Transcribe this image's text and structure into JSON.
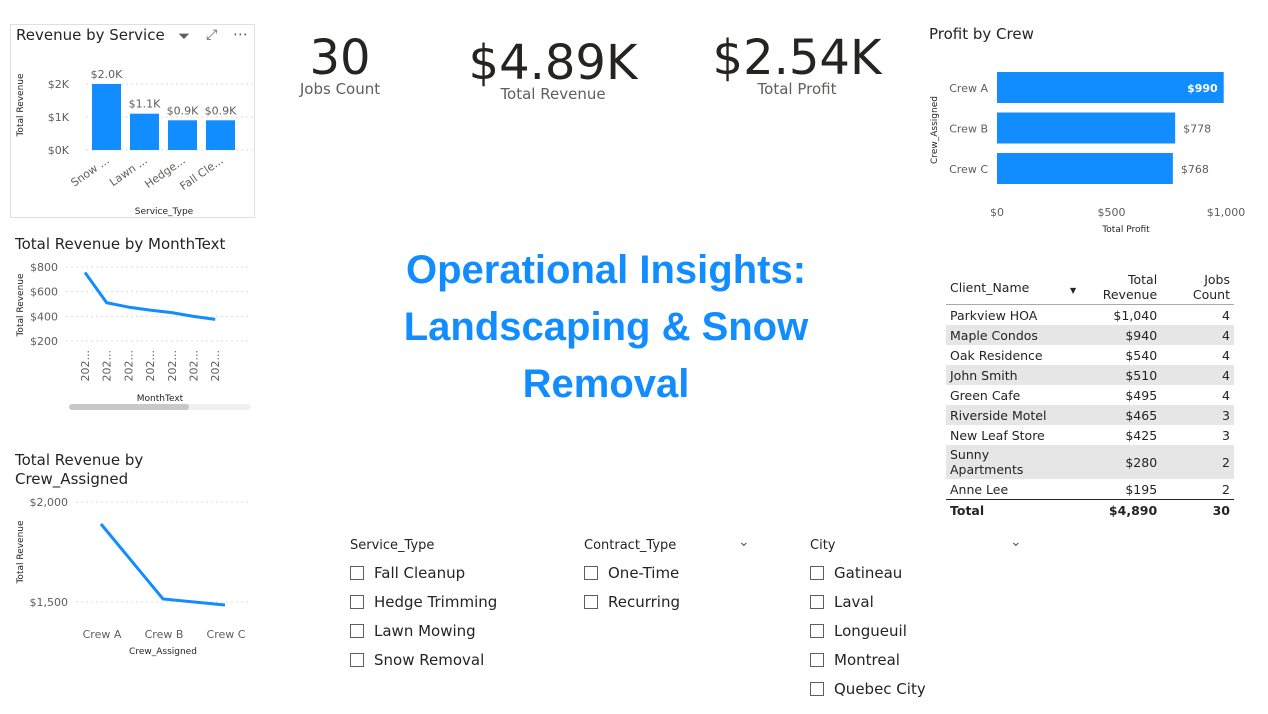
{
  "main_title": "Operational Insights: Landscaping & Snow Removal",
  "kpis": [
    {
      "value": "30",
      "label": "Jobs Count"
    },
    {
      "value": "$4.89K",
      "label": "Total Revenue"
    },
    {
      "value": "$2.54K",
      "label": "Total Profit"
    }
  ],
  "chart_data": [
    {
      "type": "bar",
      "title": "Revenue by Service",
      "categories": [
        "Snow ...",
        "Lawn ...",
        "Hedge...",
        "Fall Cle..."
      ],
      "values": [
        2000,
        1100,
        900,
        900
      ],
      "data_labels": [
        "$2.0K",
        "$1.1K",
        "$0.9K",
        "$0.9K"
      ],
      "xlabel": "Service_Type",
      "ylabel": "Total Revenue",
      "yticks": [
        "$0K",
        "$1K",
        "$2K"
      ],
      "ylim": [
        0,
        2400
      ]
    },
    {
      "type": "line",
      "title": "Total Revenue by MonthText",
      "categories": [
        "202...",
        "202...",
        "202...",
        "202...",
        "202...",
        "202...",
        "202..."
      ],
      "values": [
        755,
        510,
        475,
        450,
        430,
        400,
        375
      ],
      "xlabel": "MonthText",
      "ylabel": "Total Revenue",
      "yticks": [
        "$800",
        "$600",
        "$400",
        "$200"
      ],
      "ylim": [
        200,
        800
      ]
    },
    {
      "type": "line",
      "title": "Total Revenue by Crew_Assigned",
      "categories": [
        "Crew A",
        "Crew B",
        "Crew C"
      ],
      "values": [
        1890,
        1515,
        1485
      ],
      "xlabel": "Crew_Assigned",
      "ylabel": "Total Revenue",
      "yticks": [
        "$2,000",
        "$1,500"
      ],
      "ylim": [
        1450,
        2000
      ]
    },
    {
      "type": "bar",
      "orientation": "horizontal",
      "title": "Profit by Crew",
      "categories": [
        "Crew A",
        "Crew B",
        "Crew C"
      ],
      "values": [
        990,
        778,
        768
      ],
      "data_labels": [
        "$990",
        "$778",
        "$768"
      ],
      "xlabel": "Total Profit",
      "ylabel": "Crew_Assigned",
      "xticks": [
        "$0",
        "$500",
        "$1,000"
      ],
      "xlim": [
        0,
        1000
      ]
    }
  ],
  "table": {
    "headers": [
      "Client_Name",
      "Total Revenue",
      "Jobs Count"
    ],
    "rows": [
      [
        "Parkview HOA",
        "$1,040",
        "4"
      ],
      [
        "Maple Condos",
        "$940",
        "4"
      ],
      [
        "Oak Residence",
        "$540",
        "4"
      ],
      [
        "John Smith",
        "$510",
        "4"
      ],
      [
        "Green Cafe",
        "$495",
        "4"
      ],
      [
        "Riverside Motel",
        "$465",
        "3"
      ],
      [
        "New Leaf Store",
        "$425",
        "3"
      ],
      [
        "Sunny Apartments",
        "$280",
        "2"
      ],
      [
        "Anne Lee",
        "$195",
        "2"
      ]
    ],
    "total": [
      "Total",
      "$4,890",
      "30"
    ]
  },
  "slicers": [
    {
      "title": "Service_Type",
      "options": [
        "Fall Cleanup",
        "Hedge Trimming",
        "Lawn Mowing",
        "Snow Removal"
      ]
    },
    {
      "title": "Contract_Type",
      "options": [
        "One-Time",
        "Recurring"
      ]
    },
    {
      "title": "City",
      "options": [
        "Gatineau",
        "Laval",
        "Longueuil",
        "Montreal",
        "Quebec City"
      ]
    }
  ],
  "colors": {
    "accent": "#118dff"
  }
}
